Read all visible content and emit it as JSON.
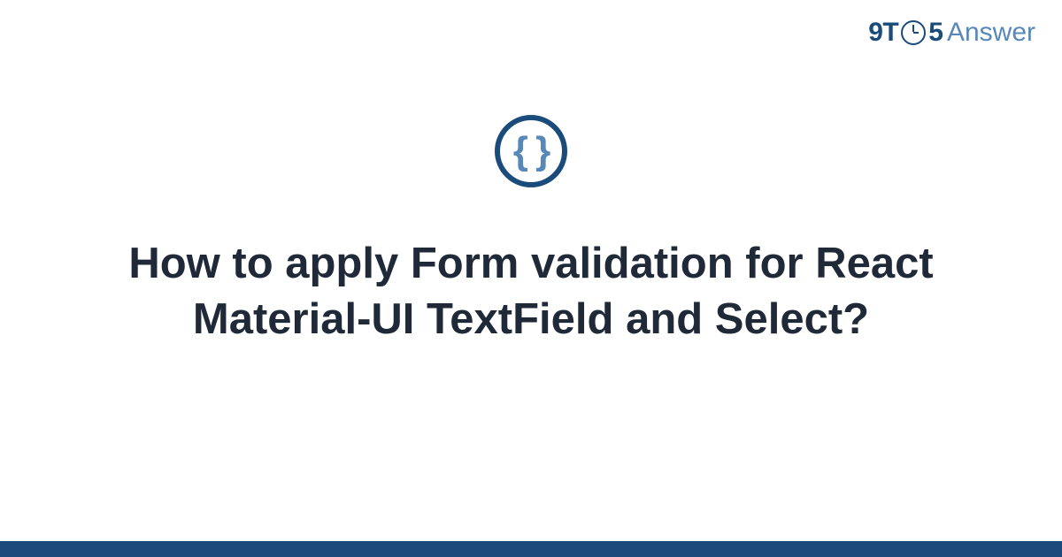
{
  "brand": {
    "part1": "9T",
    "part2": "5",
    "part3": "Answer"
  },
  "icon": {
    "name": "code-braces-icon",
    "glyph": "{ }"
  },
  "title": "How to apply Form validation for React Material-UI TextField and Select?",
  "colors": {
    "primary": "#1a4b7a",
    "secondary": "#5788b8",
    "text": "#1f2937"
  }
}
